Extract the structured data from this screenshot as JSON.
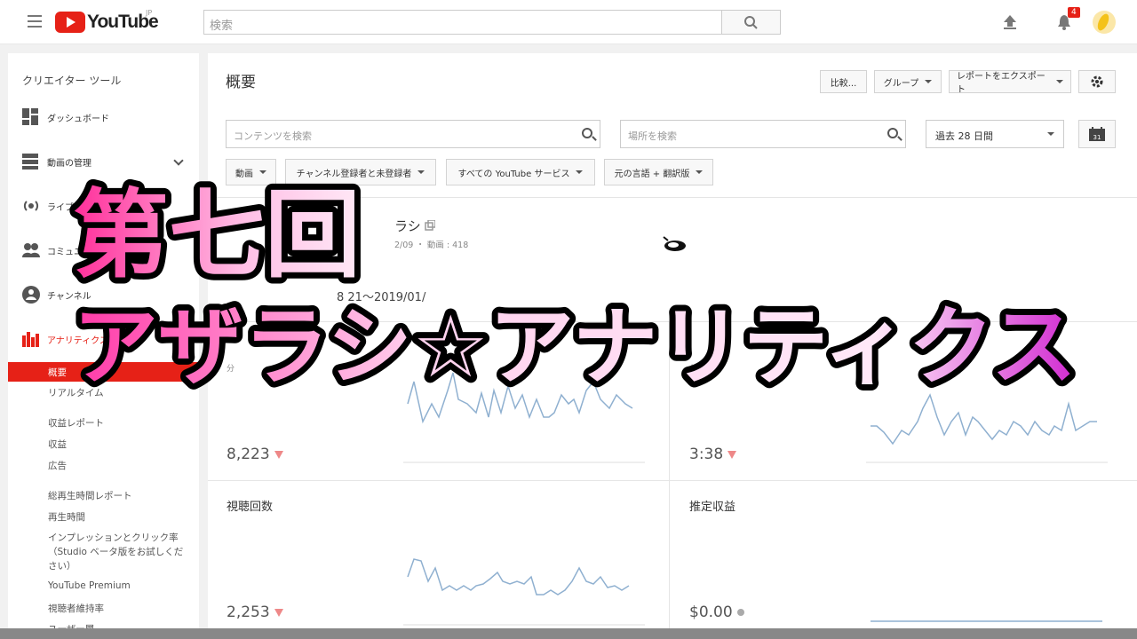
{
  "header": {
    "logo_text": "YouTube",
    "logo_region": "JP",
    "search_placeholder": "検索",
    "notification_count": "4"
  },
  "sidebar": {
    "title": "クリエイター ツール",
    "items": [
      {
        "label": "ダッシュボード",
        "icon": "dashboard-icon"
      },
      {
        "label": "動画の管理",
        "icon": "video-manager-icon"
      },
      {
        "label": "ライブ",
        "icon": "live-icon"
      },
      {
        "label": "コミュニティ",
        "icon": "community-icon"
      },
      {
        "label": "チャンネル",
        "icon": "channel-icon"
      },
      {
        "label": "アナリティクス",
        "icon": "analytics-icon"
      }
    ],
    "analytics_sub": {
      "active": "概要",
      "items": [
        "リアルタイム",
        "収益レポート",
        "収益",
        "広告",
        "総再生時間レポート",
        "再生時間",
        "インプレッションとクリック率",
        "（Studio ベータ版をお試しくだ",
        "さい）",
        "YouTube Premium",
        "視聴者維持率",
        "ユーザー層"
      ]
    }
  },
  "main": {
    "title": "概要",
    "buttons": {
      "compare": "比較...",
      "group": "グループ",
      "export": "レポートをエクスポート"
    },
    "content_search_placeholder": "コンテンツを検索",
    "location_search_placeholder": "場所を検索",
    "period": "過去 28 日間",
    "calendar_day": "31",
    "filters": [
      "動画",
      "チャンネル登録者と未登録者",
      "すべての YouTube サービス",
      "元の言語 + 翻訳版"
    ],
    "channel_name_partial": "ラシ",
    "channel_meta": "2/09 ・ 動画 : 418",
    "date_range_partial": "8   21〜2019/01/",
    "cards": [
      {
        "title": "",
        "unit": "分",
        "value": "8,223",
        "trend": "down"
      },
      {
        "title": "",
        "unit": "分",
        "value": "3:38",
        "trend": "down"
      },
      {
        "title": "視聴回数",
        "unit": "",
        "value": "2,253",
        "trend": "down"
      },
      {
        "title": "推定収益",
        "unit": "",
        "value": "$0.00",
        "trend": "neutral"
      }
    ]
  },
  "overlay": {
    "line1": "第七回",
    "line2": "アザラシ☆アナリティクス"
  },
  "colors": {
    "brand_red": "#e62117",
    "overlay_pink": "#ff4fb0",
    "overlay_magenta": "#cc22cc",
    "spark_blue": "#8fb0d0"
  }
}
